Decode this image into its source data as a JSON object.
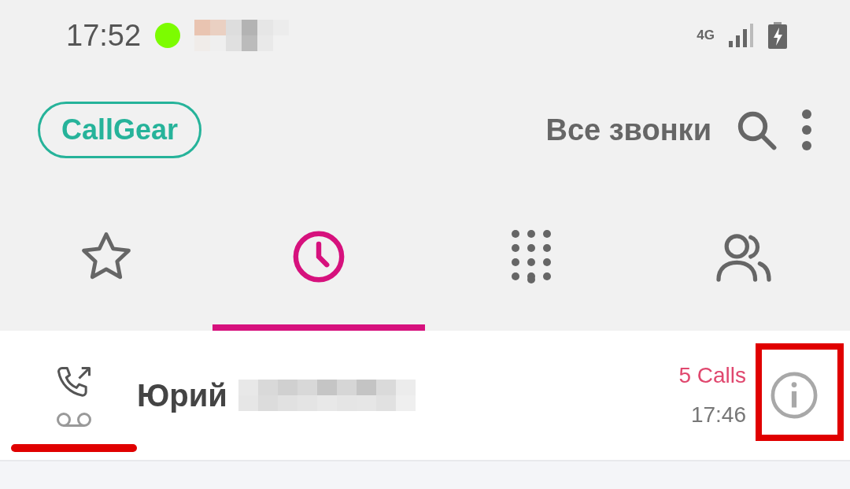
{
  "status_bar": {
    "time": "17:52",
    "network": "4G"
  },
  "header": {
    "logo": "CallGear",
    "filter": "Все звонки"
  },
  "tabs": [
    {
      "kind": "favorites",
      "selected": false
    },
    {
      "kind": "recents",
      "selected": true
    },
    {
      "kind": "keypad",
      "selected": false
    },
    {
      "kind": "contacts",
      "selected": false
    }
  ],
  "calls": [
    {
      "name": "Юрий",
      "count": "5 Calls",
      "time": "17:46",
      "voicemail": true,
      "highlighted": true
    }
  ]
}
